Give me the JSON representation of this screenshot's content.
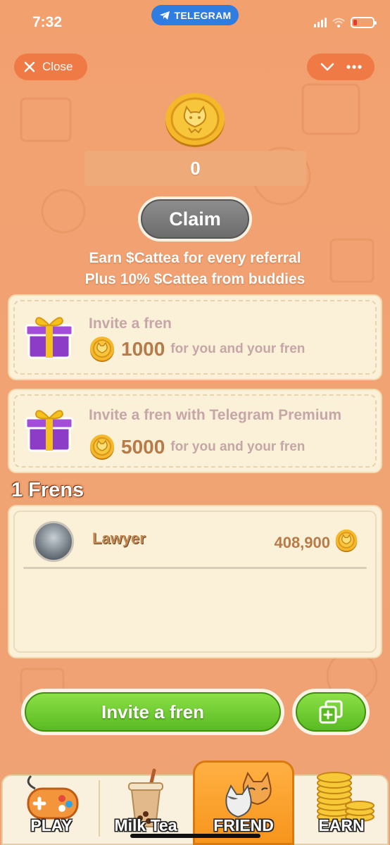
{
  "status_bar": {
    "time": "7:32",
    "app_badge": "TELEGRAM"
  },
  "top_bar": {
    "close_label": "Close"
  },
  "balance": {
    "value": "0"
  },
  "claim": {
    "label": "Claim"
  },
  "earn_info": {
    "line1": "Earn $Cattea for every referral",
    "line2": "Plus 10% $Cattea from buddies"
  },
  "invite_cards": [
    {
      "title": "Invite a fren",
      "amount": "1000",
      "text": "for you and your fren"
    },
    {
      "title": "Invite a fren with Telegram Premium",
      "amount": "5000",
      "text": "for you and your fren"
    }
  ],
  "frens": {
    "count_label": "1 Frens",
    "list": [
      {
        "name": "Lawyer",
        "score": "408,900"
      }
    ]
  },
  "invite_button": {
    "label": "Invite a fren"
  },
  "bottom_nav": [
    {
      "label": "PLAY",
      "active": false
    },
    {
      "label": "Milk Tea",
      "active": false
    },
    {
      "label": "FRIEND",
      "active": true
    },
    {
      "label": "EARN",
      "active": false
    }
  ],
  "colors": {
    "background": "#f1a373",
    "card": "#fbf1d8",
    "accent_green": "#6cc832",
    "active_tab": "#f7951c",
    "telegram_blue": "#2f7de0"
  }
}
